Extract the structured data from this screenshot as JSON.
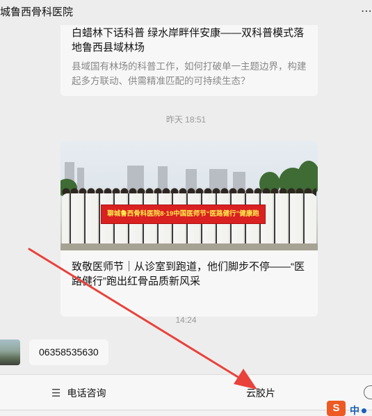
{
  "header": {
    "title": "城鲁西骨科医院",
    "more_icon": "more-icon"
  },
  "messages": {
    "card1": {
      "title": "白蜡林下话科普  绿水岸畔伴安康——双科普模式落地鲁西县域林场",
      "desc": "县域国有林场的科普工作，如何打破单一主题边界，构建起多方联动、供需精准匹配的可持续生态？"
    },
    "time1": "昨天 18:51",
    "card2": {
      "banner_text": "聊城鲁西骨科医院8·19中国医师节“医路健行”健康跑",
      "title": "致敬医师节｜从诊室到跑道，他们脚步不停——“医路健行”跑出红骨品质新风采"
    },
    "time2": "14:24",
    "phone_message": "06358535630"
  },
  "bottom_menu": {
    "item1": "电话咨询",
    "item2": "云胶片"
  },
  "taskbar": {
    "ime_logo": "S",
    "ime_lang": "中"
  },
  "colors": {
    "background": "#ededed",
    "card": "#f7f7f7",
    "arrow": "#e8423b",
    "banner": "#d92121"
  }
}
